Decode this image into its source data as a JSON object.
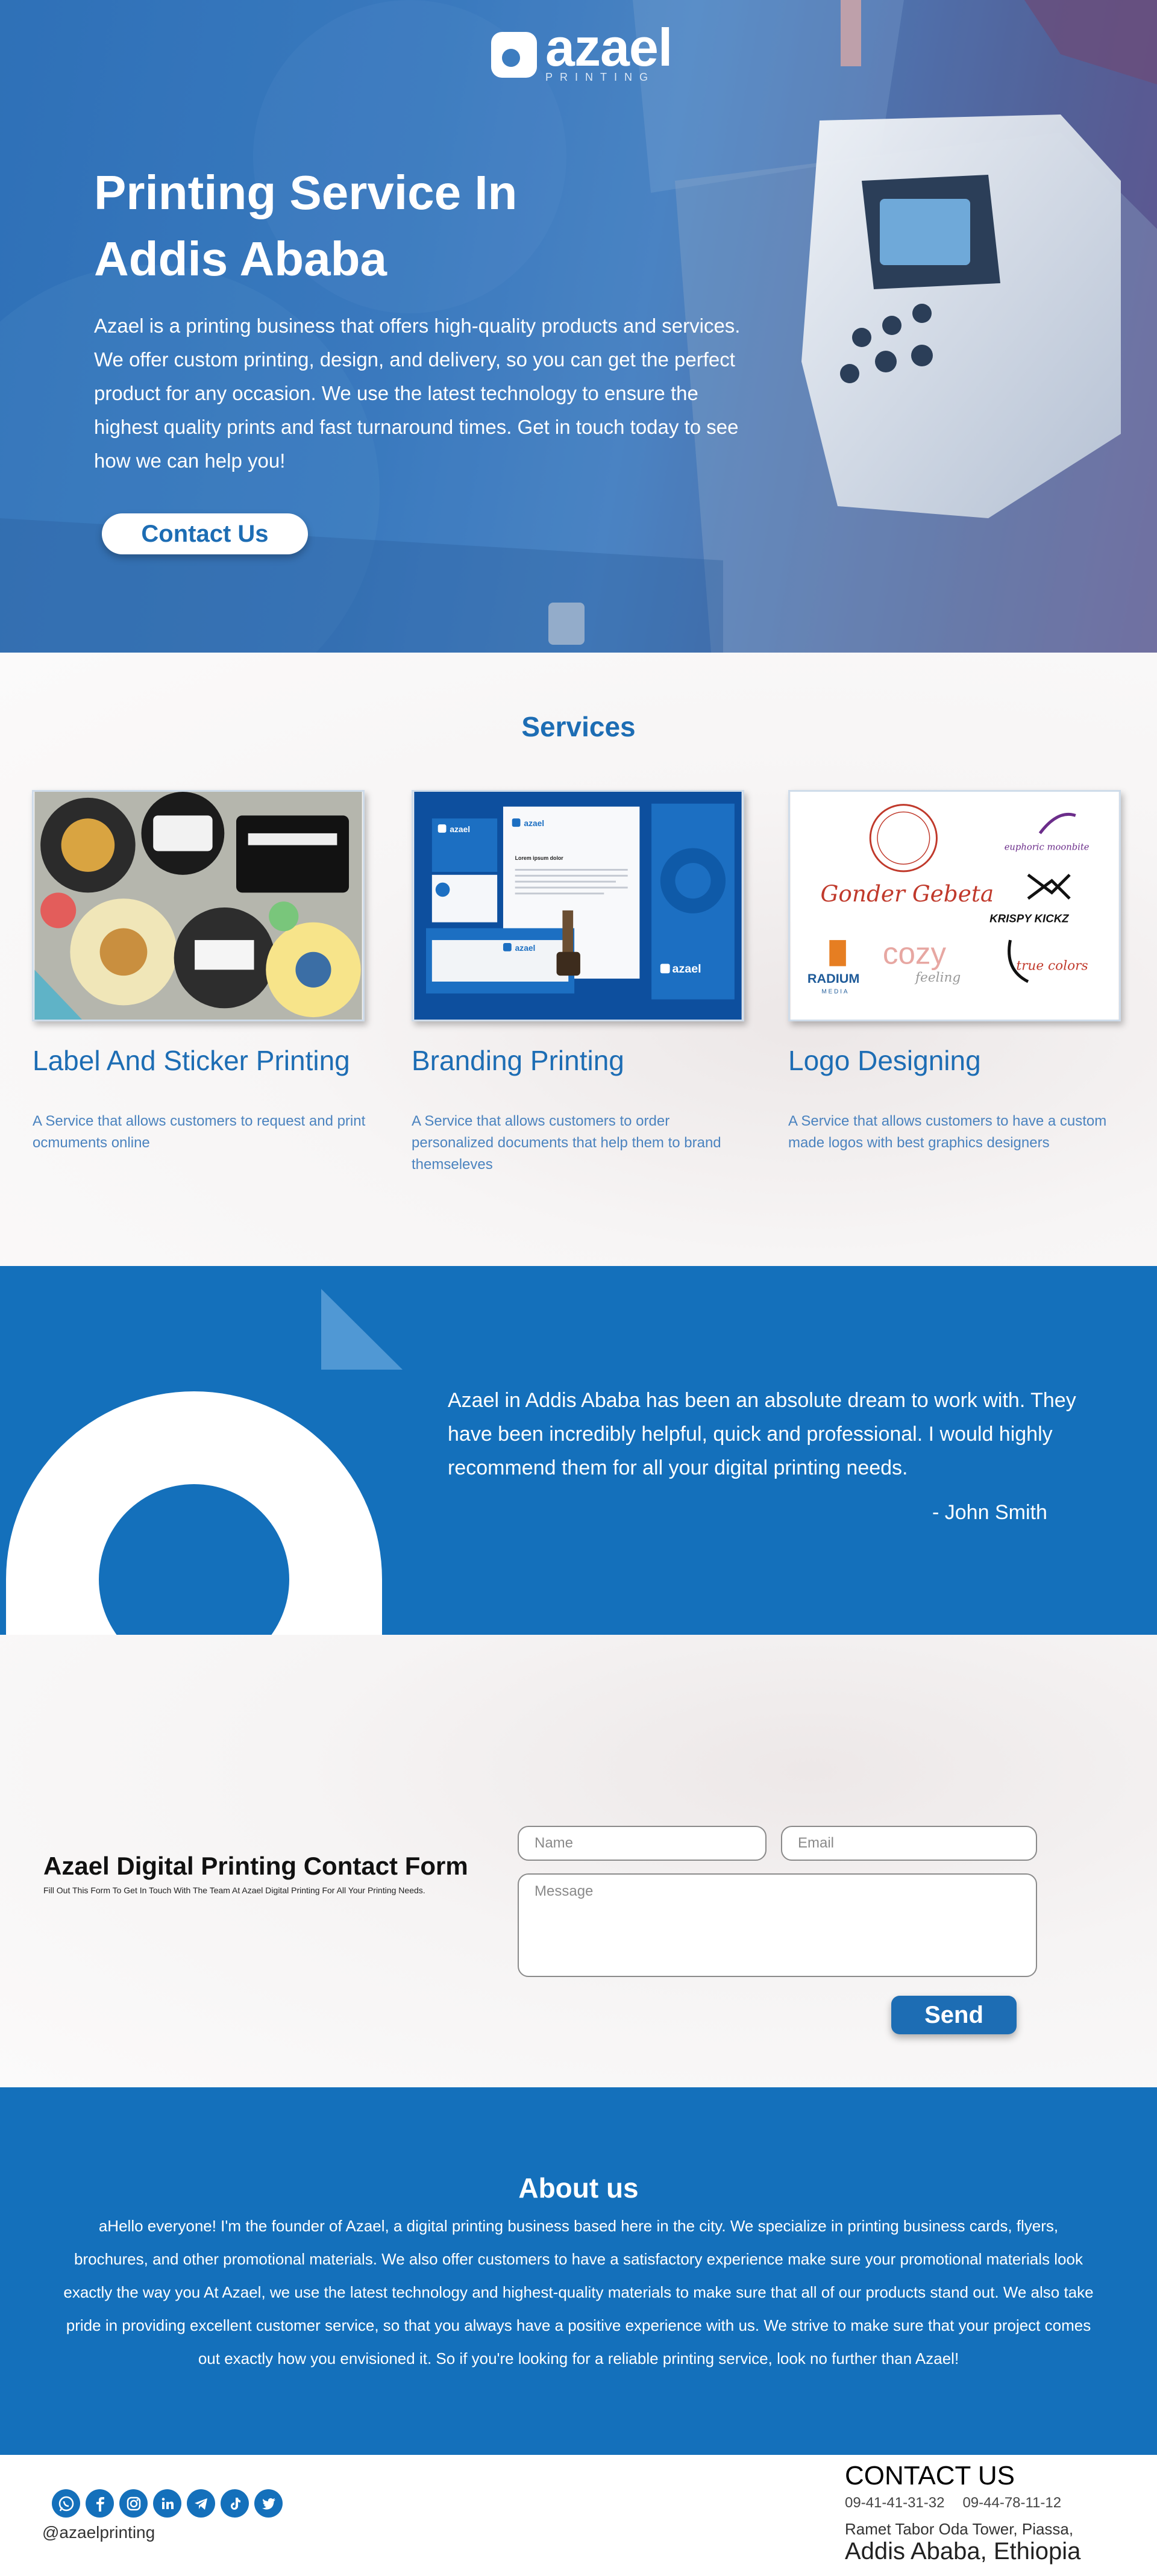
{
  "hero": {
    "logo_word": "azael",
    "logo_sub": "PRINTING",
    "title_line1": "Printing Service In",
    "title_line2": "Addis Ababa",
    "description": "Azael is a printing business that offers high-quality products and services. We offer custom printing, design, and delivery, so you can get the perfect product for any occasion. We use the latest technology to ensure the highest quality prints and fast turnaround times. Get in touch today to see how we can help you!",
    "cta_label": "Contact Us"
  },
  "services": {
    "title": "Services",
    "items": [
      {
        "name": "Label And Sticker  Printing",
        "description": "A Service that allows customers to request and print ocmuments online"
      },
      {
        "name": "Branding Printing",
        "description": "A Service that allows customers to order personalized documents that help them to brand themseleves"
      },
      {
        "name": "Logo Designing",
        "description": "A Service that allows customers to have a custom made logos with  best graphics designers"
      }
    ],
    "branding_sample": {
      "logo": "azael",
      "doc_heading": "Lorem ipsum dolor"
    },
    "logo_samples": [
      "Gonder Gebeta",
      "euphoric moonbite",
      "KRISPY KICKZ",
      "RADIUM",
      "MEDIA",
      "cozy",
      "feeling",
      "true colors"
    ]
  },
  "testimonial": {
    "quote": "Azael in Addis Ababa has been an absolute dream to work with. They have been incredibly helpful, quick and professional. I would highly recommend them for all your digital printing needs.",
    "author": "- John Smith"
  },
  "contact_form": {
    "title": "Azael Digital Printing Contact Form",
    "subtitle": "Fill Out This Form To Get In Touch With The Team At Azael Digital Printing For All Your Printing Needs.",
    "name_placeholder": "Name",
    "email_placeholder": "Email",
    "message_placeholder": "Message",
    "send_label": "Send"
  },
  "about": {
    "title": "About us",
    "text": "aHello everyone! I'm the founder of Azael, a digital printing business based here in the city. We specialize in printing business cards, flyers, brochures, and other promotional materials. We also offer customers to have a satisfactory experience make sure your promotional materials look exactly the way you At Azael, we use the latest technology and highest-quality materials to make sure that all of our products stand out. We also take pride in providing excellent customer service, so that you always have a positive experience with us. We strive to make sure that your project comes out exactly how you envisioned it. So if you're looking for a reliable printing service, look no further than Azael!"
  },
  "footer": {
    "social_icons": [
      "whatsapp-icon",
      "facebook-icon",
      "instagram-icon",
      "linkedin-icon",
      "telegram-icon",
      "tiktok-icon",
      "twitter-icon"
    ],
    "handle": "@azaelprinting",
    "contact_title": "CONTACT US",
    "phone1": "09-41-41-31-32",
    "phone2": "09-44-78-11-12",
    "address_line1": "Ramet Tabor Oda Tower, Piassa,",
    "address_line2": "Addis Ababa, Ethiopia"
  },
  "colors": {
    "brand_blue": "#1470bb",
    "text_blue": "#1d6db4",
    "light_text_blue": "#4b83bf"
  }
}
